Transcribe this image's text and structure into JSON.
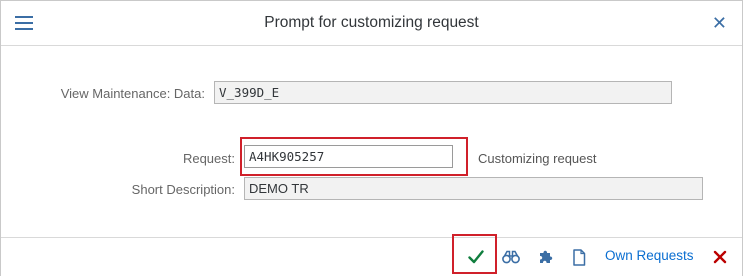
{
  "dialog": {
    "title": "Prompt for customizing request"
  },
  "form": {
    "view_label": "View Maintenance: Data:",
    "view_value": "V_399D_E",
    "request_label": "Request:",
    "request_value": "A4HK905257",
    "request_type_text": "Customizing request",
    "short_desc_label": "Short Description:",
    "short_desc_value": "DEMO TR"
  },
  "footer": {
    "own_requests_label": "Own Requests"
  },
  "colors": {
    "accent": "#0a6ed1",
    "icon_blue": "#3b6ea5",
    "confirm_green": "#107e3e",
    "cancel_red": "#bb0000",
    "highlight_red": "#d0202a"
  },
  "icons": [
    "menu-icon",
    "close-icon",
    "checkmark-icon",
    "binoculars-icon",
    "puzzle-icon",
    "document-icon",
    "cancel-icon"
  ]
}
